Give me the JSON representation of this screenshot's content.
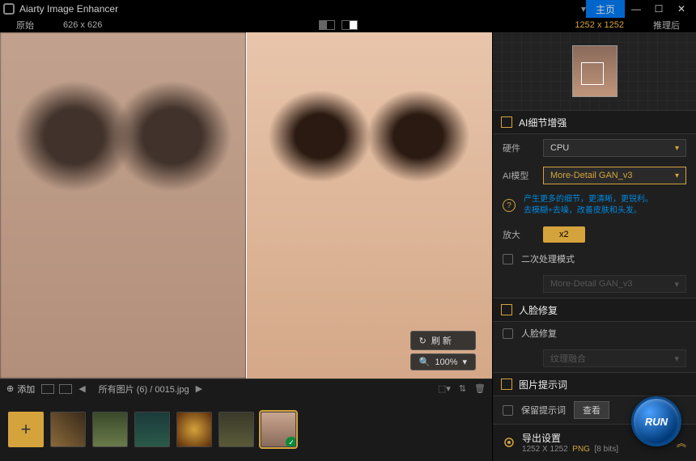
{
  "app": {
    "title": "Aiarty Image Enhancer",
    "home_label": "主页"
  },
  "toolbar": {
    "original_label": "原始",
    "original_dims": "626 x 626",
    "enhanced_dims": "1252 x 1252",
    "after_label": "推理后"
  },
  "preview": {
    "refresh_label": "刷 新",
    "zoom_label": "100%"
  },
  "bottombar": {
    "add_label": "添加",
    "path_prefix": "所有图片",
    "count": "(6)",
    "filename": "0015.jpg"
  },
  "panel": {
    "detail_enhance": {
      "title": "AI细节增强"
    },
    "hardware": {
      "label": "硬件",
      "value": "CPU"
    },
    "model": {
      "label": "AI模型",
      "value": "More-Detail GAN_v3",
      "desc1": "产生更多的细节，更清晰，更锐利。",
      "desc2": "去模糊+去噪，改善皮肤和头发。"
    },
    "scale": {
      "label": "放大",
      "value": "x2"
    },
    "secondary": {
      "label": "二次处理模式",
      "disabled_value": "More-Detail GAN_v3"
    },
    "face_repair": {
      "title": "人脸修复",
      "checkbox_label": "人脸修复",
      "blend_placeholder": "纹理融合"
    },
    "prompt": {
      "title": "图片提示词",
      "keep_label": "保留提示词",
      "view_btn": "查看"
    },
    "export": {
      "title": "导出设置",
      "dims": "1252 X 1252",
      "format": "PNG",
      "bits": "[8 bits]"
    }
  },
  "run": {
    "label": "RUN"
  }
}
